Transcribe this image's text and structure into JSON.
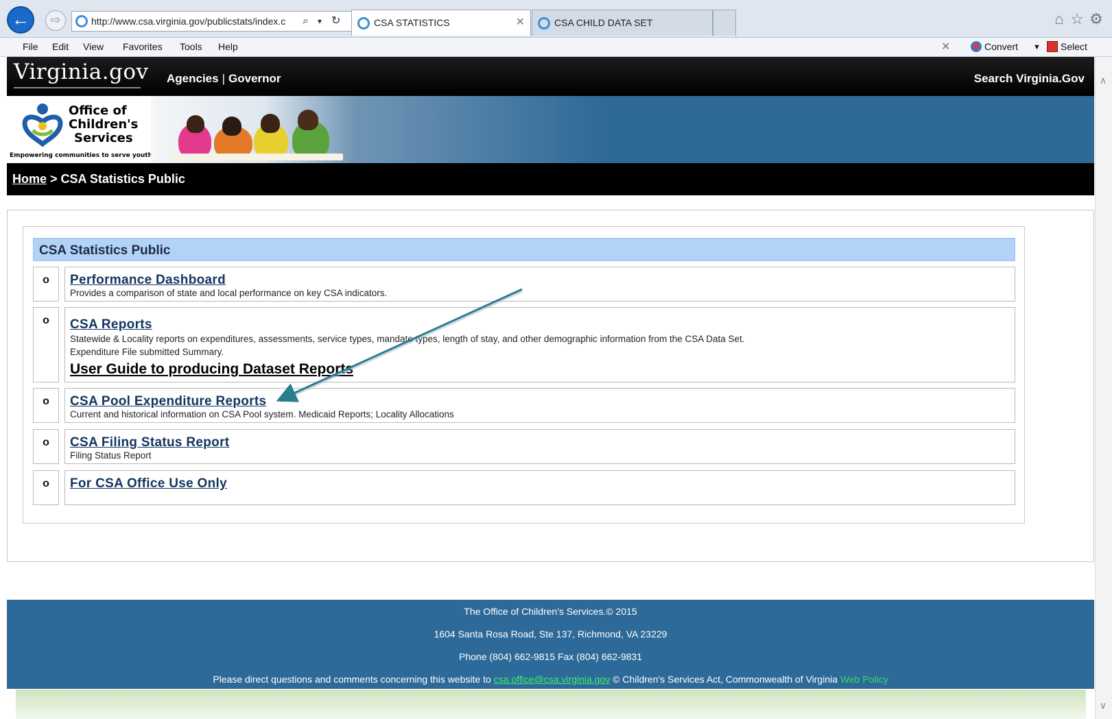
{
  "browser": {
    "url": "http://www.csa.virginia.gov/publicstats/index.c",
    "tabs": [
      {
        "title": "CSA STATISTICS",
        "active": true
      },
      {
        "title": "CSA CHILD DATA SET",
        "active": false
      }
    ],
    "menu": [
      "File",
      "Edit",
      "View",
      "Favorites",
      "Tools",
      "Help"
    ],
    "commands": {
      "convert": "Convert",
      "select": "Select"
    }
  },
  "vgov": {
    "logo": "Virginia.gov",
    "nav_agencies": "Agencies",
    "nav_sep": "|",
    "nav_governor": "Governor",
    "search": "Search Virginia.Gov"
  },
  "banner": {
    "org_line1": "Office of",
    "org_line2": "Children's",
    "org_line3": "Services",
    "tagline": "Empowering communities to serve youth",
    "logo_colors": {
      "blue": "#1f5fa8",
      "yellow": "#e8c21a",
      "green": "#7bbd3a"
    }
  },
  "breadcrumb": {
    "home": "Home",
    "separator": " > ",
    "current": "CSA Statistics Public"
  },
  "panel": {
    "title": "CSA Statistics Public",
    "bullet": "o",
    "items": [
      {
        "title": "Performance Dashboard",
        "desc": "Provides a comparison of state and local performance on key CSA indicators."
      },
      {
        "title": "CSA Reports",
        "desc": "Statewide & Locality reports on expenditures, assessments, service types, mandate types, length of stay, and other demographic information from the CSA Data Set.",
        "desc2": "Expenditure File submitted Summary.",
        "guide": "User Guide to producing Dataset Reports"
      },
      {
        "title": "CSA Pool Expenditure Reports",
        "desc": "Current and historical information on CSA Pool system. Medicaid Reports; Locality Allocations"
      },
      {
        "title": "CSA Filing Status Report",
        "desc": "Filing Status Report"
      },
      {
        "title": "For CSA Office Use Only"
      }
    ]
  },
  "annotation": {
    "arrow_color": "#2c7d8f"
  },
  "footer": {
    "line1": "The Office of Children's Services.© 2015",
    "line2": "1604 Santa Rosa Road, Ste 137, Richmond, VA 23229",
    "line3": "Phone (804) 662-9815  Fax (804) 662-9831",
    "line4_pre": "Please direct questions and comments concerning this website to ",
    "email": "csa.office@csa.virginia.gov",
    "line4_mid": " © Children's Services Act, Commonwealth of Virginia ",
    "policy": "Web Policy"
  }
}
